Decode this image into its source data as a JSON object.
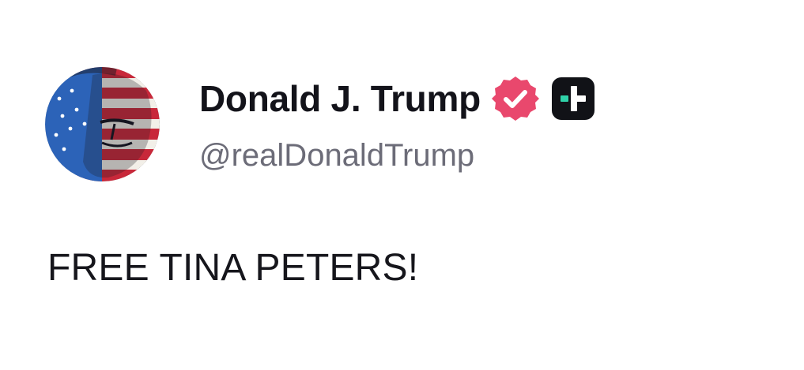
{
  "author": {
    "display_name": "Donald J. Trump",
    "handle": "@realDonaldTrump",
    "avatar": "avatar-flag-portrait",
    "verified": true,
    "verified_icon": "verified-badge-icon",
    "verified_color": "#e9486d",
    "plus_icon": "plus-badge-icon",
    "plus_badge_bg": "#111217",
    "plus_badge_accent": "#2fd1a8"
  },
  "post": {
    "text": "FREE TINA PETERS!"
  }
}
